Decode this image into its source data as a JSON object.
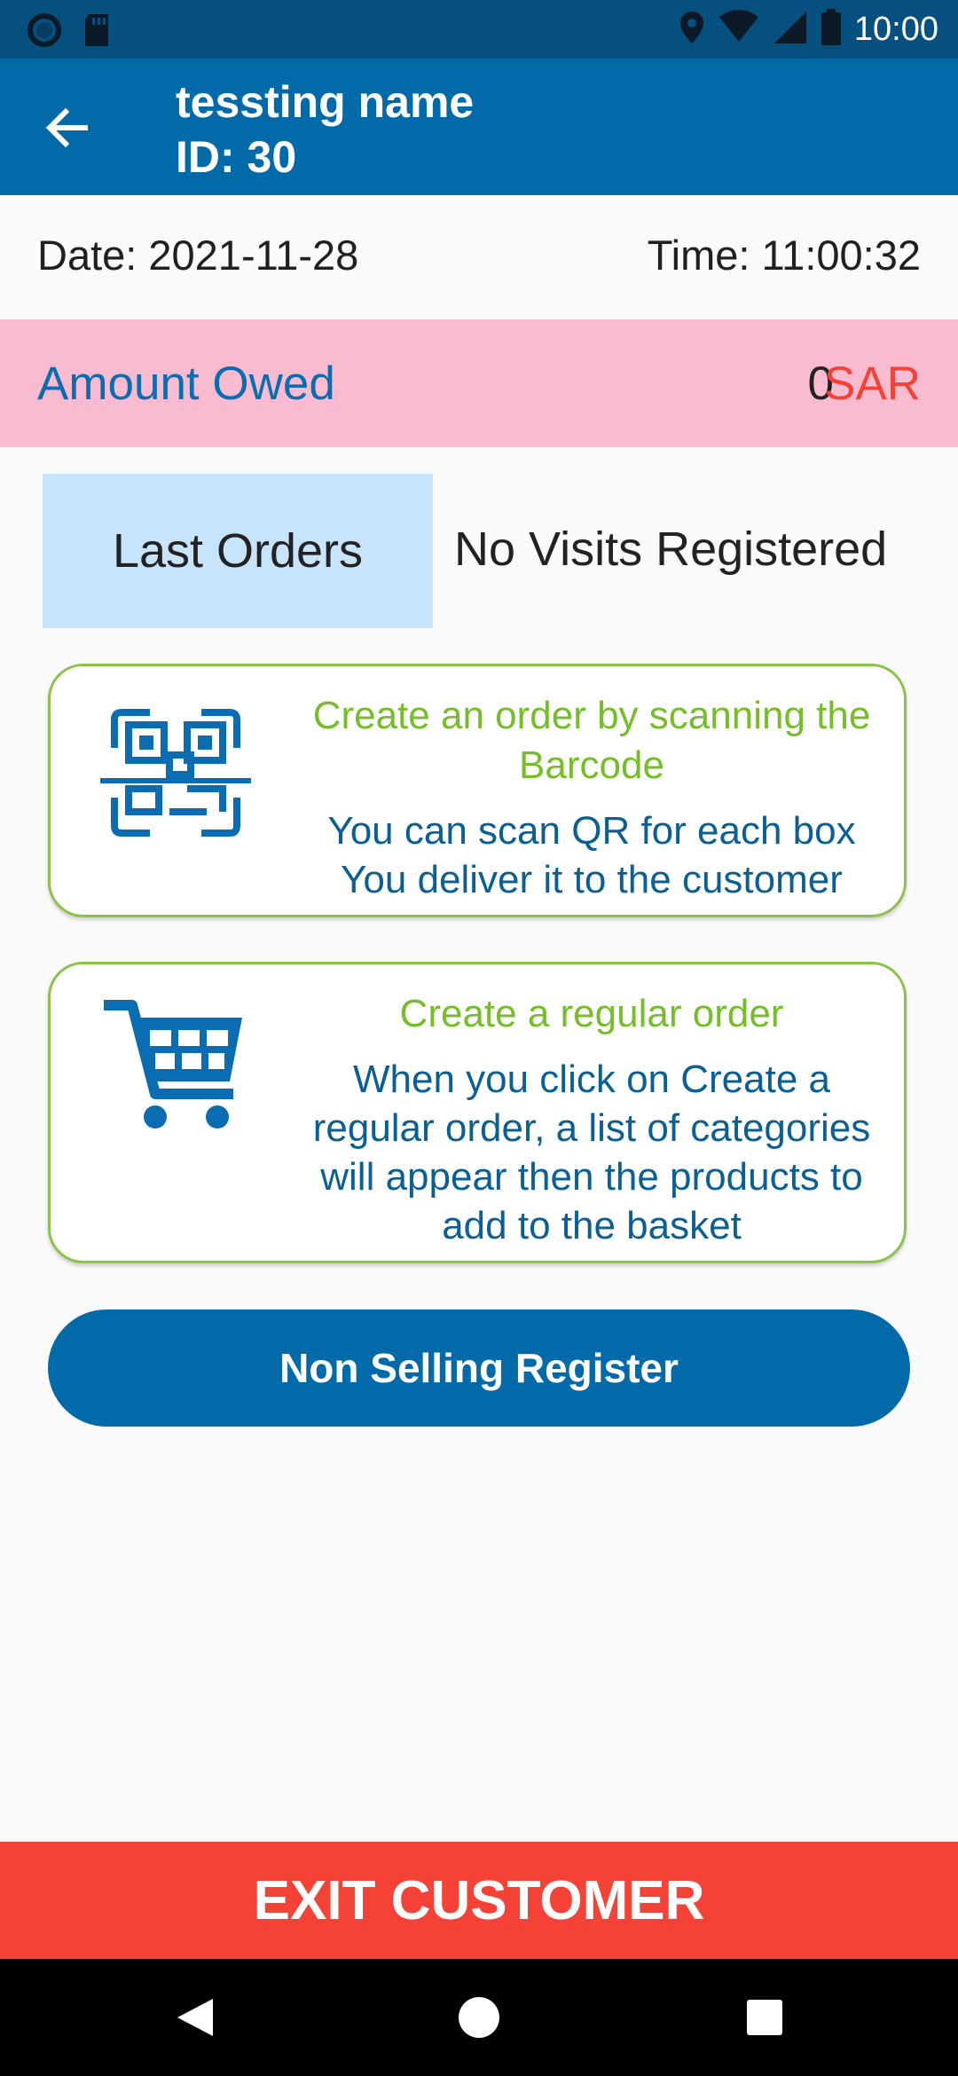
{
  "status_bar": {
    "time": "10:00",
    "icons": [
      "record-icon",
      "sd-card-icon",
      "location-icon",
      "wifi-icon",
      "signal-icon",
      "battery-icon"
    ]
  },
  "app_bar": {
    "title": "tessting name",
    "subtitle": "ID: 30",
    "back_icon": "arrow-left-icon"
  },
  "visit": {
    "date": "Date: 2021-11-28",
    "time": "Time: 11:00:32"
  },
  "amount_owed": {
    "label": "Amount Owed",
    "amount": "0",
    "currency": "SAR"
  },
  "orders": {
    "last_orders_label": "Last Orders",
    "visits_status": "No Visits Registered"
  },
  "cards": {
    "scan": {
      "title": "Create an order by scanning the Barcode",
      "description": "You can scan QR for each box You deliver it to the customer",
      "icon": "qr-scan-icon"
    },
    "regular": {
      "title": "Create a regular order",
      "description": "When you click on Create a regular order, a list of categories will appear then the products to add to the basket",
      "icon": "cart-icon"
    }
  },
  "buttons": {
    "non_selling": "Non Selling Register",
    "exit_customer": "EXIT CUSTOMER"
  },
  "colors": {
    "status_bar": "#05507f",
    "app_bar": "#036aa9",
    "owed_bg": "#f8bbd0",
    "owed_label": "#0a6db1",
    "currency": "#f44336",
    "last_orders_bg": "#c8e4fb",
    "card_border": "#8bc34a",
    "card_title": "#76bd2a",
    "card_text": "#0a5f95",
    "exit_bg": "#f44336"
  },
  "nav_bar": {
    "icons": [
      "back-triangle-icon",
      "home-circle-icon",
      "recents-square-icon"
    ]
  }
}
